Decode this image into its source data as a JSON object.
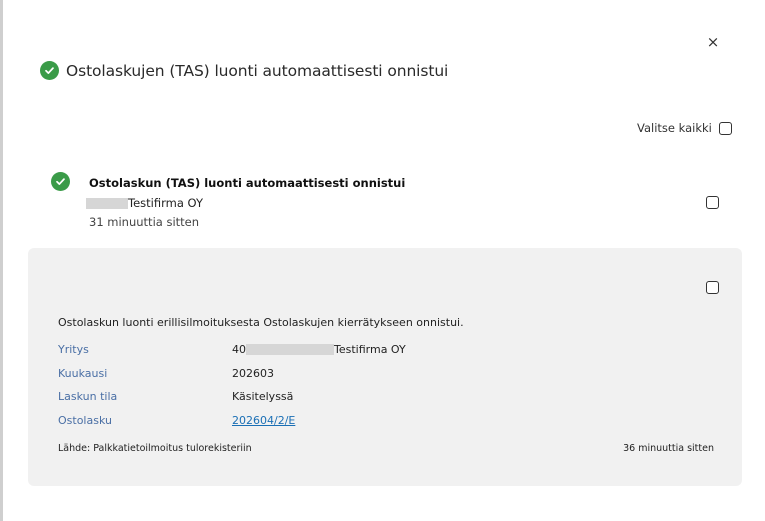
{
  "modal": {
    "title": "Ostolaskujen (TAS) luonti automaattisesti onnistui",
    "close_glyph": "×",
    "select_all_label": "Valitse kaikki"
  },
  "notification": {
    "title": "Ostolaskun (TAS) luonti automaattisesti onnistui",
    "company": "Testifirma OY",
    "time": "31 minuuttia sitten"
  },
  "detail": {
    "message": "Ostolaskun luonti erillisilmoituksesta Ostolaskujen kierrätykseen onnistui.",
    "fields": [
      {
        "label": "Yritys",
        "value_prefix": "40",
        "value": "Testifirma OY"
      },
      {
        "label": "Kuukausi",
        "value": "202603"
      },
      {
        "label": "Laskun tila",
        "value": "Käsitelyssä"
      },
      {
        "label": "Ostolasku",
        "value": "202604/2/E"
      }
    ],
    "source": "Lähde: Palkkatietoilmoitus tulorekisteriin",
    "time": "36 minuuttia sitten"
  },
  "colors": {
    "success": "#3a9b48",
    "link": "#1a6fb5",
    "label": "#4a6fa5",
    "panel_bg": "#f1f1f1"
  },
  "icons": {
    "close": "close-icon",
    "success": "check-circle-icon"
  }
}
